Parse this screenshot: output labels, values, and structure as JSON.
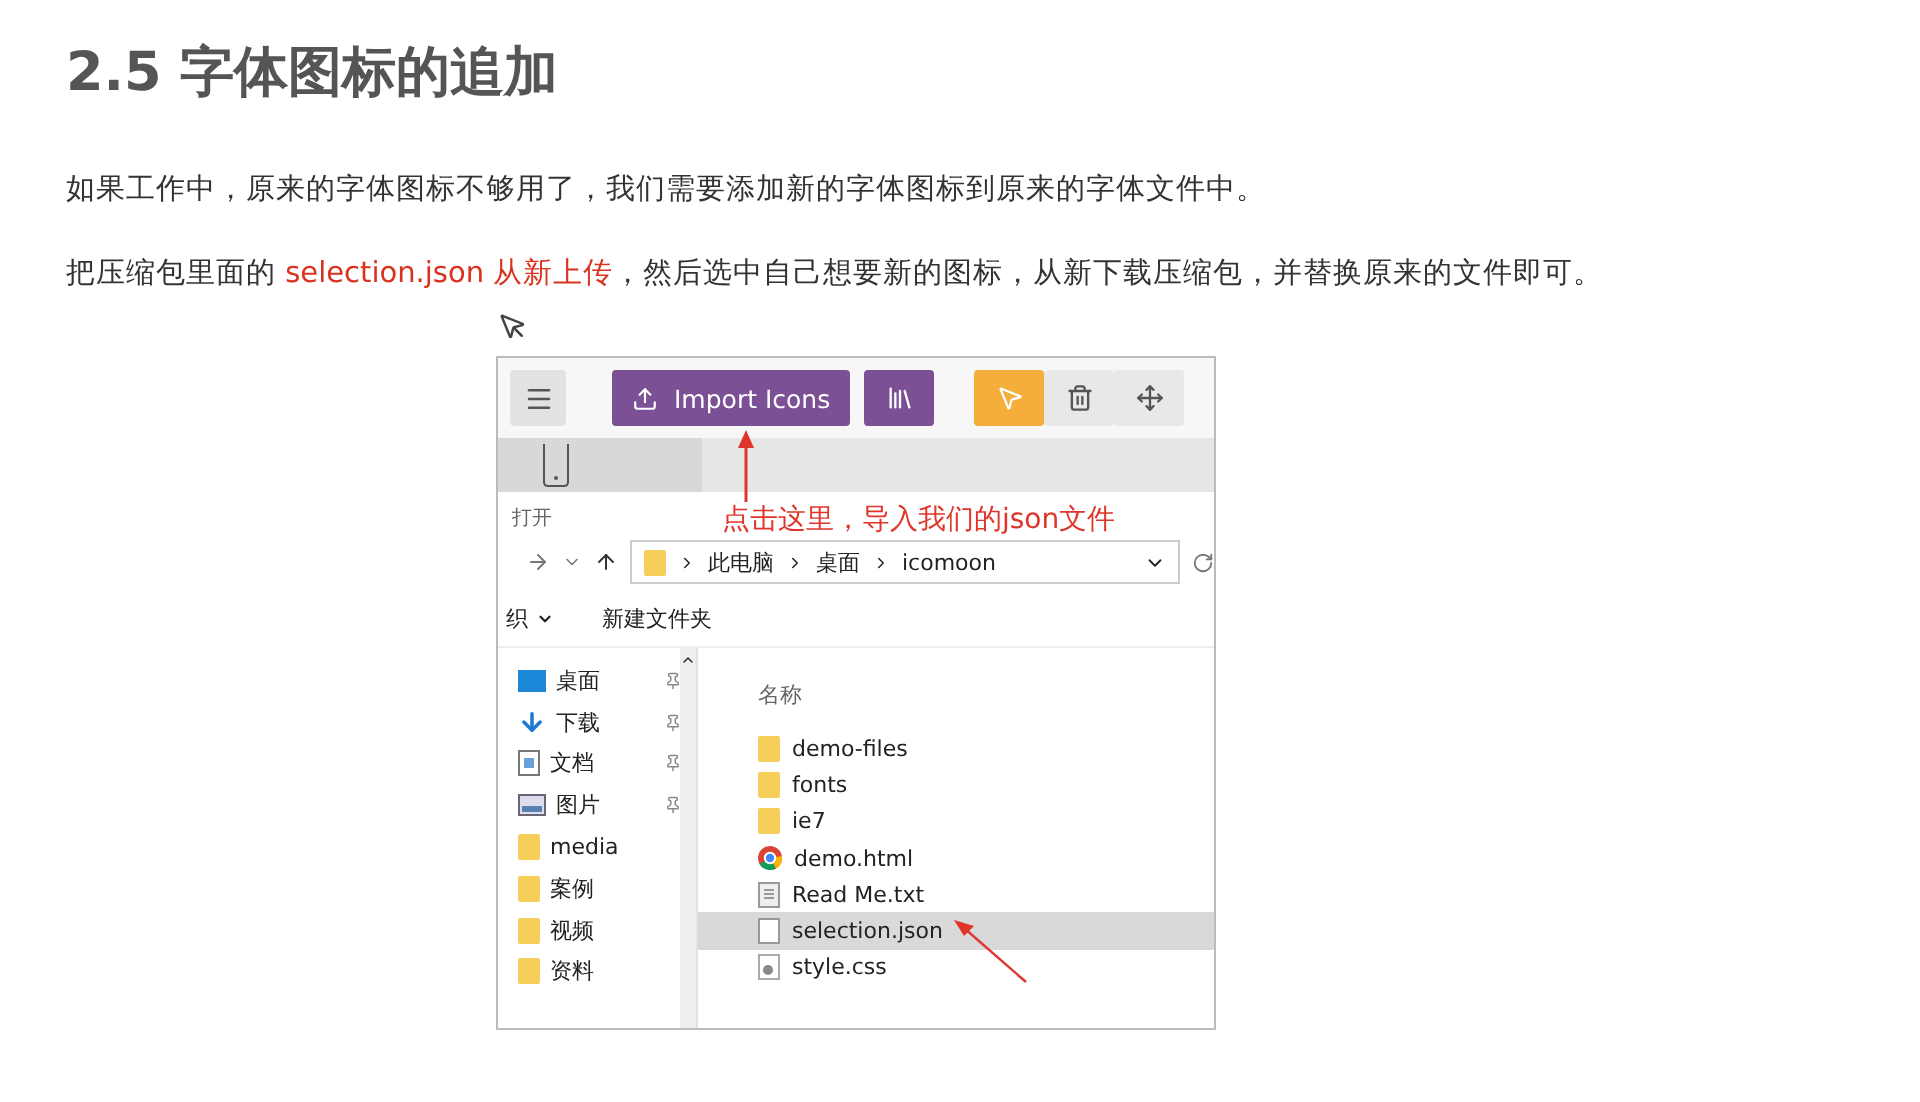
{
  "heading": "2.5 字体图标的追加",
  "paragraphs": [
    [
      {
        "text": "如果工作中，原来的字体图标不够用了，我们需要添加新的字体图标到原来的字体文件中。",
        "highlight": false
      }
    ],
    [
      {
        "text": "把压缩包里面的 ",
        "highlight": false
      },
      {
        "text": "selection.json 从新上传",
        "highlight": true
      },
      {
        "text": "，然后选中自己想要新的图标，从新下载压缩包，并替换原来的文件即可。",
        "highlight": false
      }
    ]
  ],
  "screenshot": {
    "toolbar": {
      "import_label": "Import Icons",
      "select_active": true
    },
    "open_label": "打开",
    "annotation": "点击这里，导入我们的json文件",
    "breadcrumb": [
      "此电脑",
      "桌面",
      "icomoon"
    ],
    "commands": {
      "organize": "织",
      "new_folder": "新建文件夹"
    },
    "nav_items": [
      {
        "kind": "desktop",
        "label": "桌面",
        "pinned": true
      },
      {
        "kind": "download",
        "label": "下载",
        "pinned": true
      },
      {
        "kind": "document",
        "label": "文档",
        "pinned": true
      },
      {
        "kind": "pictures",
        "label": "图片",
        "pinned": true
      },
      {
        "kind": "folder",
        "label": "media",
        "pinned": false
      },
      {
        "kind": "folder",
        "label": "案例",
        "pinned": false
      },
      {
        "kind": "folder",
        "label": "视频",
        "pinned": false
      },
      {
        "kind": "folder",
        "label": "资料",
        "pinned": false
      }
    ],
    "column_header": "名称",
    "files": [
      {
        "kind": "folder",
        "name": "demo-files",
        "selected": false
      },
      {
        "kind": "folder",
        "name": "fonts",
        "selected": false
      },
      {
        "kind": "folder",
        "name": "ie7",
        "selected": false
      },
      {
        "kind": "browser",
        "name": "demo.html",
        "selected": false
      },
      {
        "kind": "text",
        "name": "Read Me.txt",
        "selected": false
      },
      {
        "kind": "blank",
        "name": "selection.json",
        "selected": true
      },
      {
        "kind": "css",
        "name": "style.css",
        "selected": false
      }
    ]
  }
}
